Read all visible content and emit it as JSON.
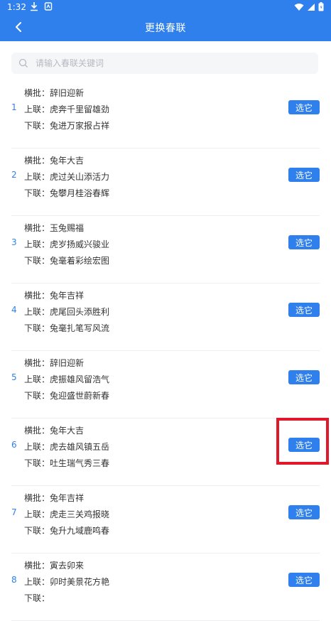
{
  "status_bar": {
    "time": "1:32"
  },
  "appbar": {
    "title": "更换春联"
  },
  "search": {
    "placeholder": "请输入春联关键词"
  },
  "labels": {
    "h": "横批：",
    "s": "上联：",
    "x": "下联：",
    "choose": "选它"
  },
  "items": [
    {
      "index": "1",
      "heng": "辞旧迎新",
      "shang": "虎奔千里留雄劲",
      "xia": "兔进万家报占祥"
    },
    {
      "index": "2",
      "heng": "兔年大吉",
      "shang": "虎过关山添活力",
      "xia": "兔攀月桂浴春辉"
    },
    {
      "index": "3",
      "heng": "玉兔赐福",
      "shang": "虎岁扬威兴骏业",
      "xia": "兔毫着彩绘宏图"
    },
    {
      "index": "4",
      "heng": "兔年吉祥",
      "shang": "虎尾回头添胜利",
      "xia": "兔毫扎笔写风流"
    },
    {
      "index": "5",
      "heng": "辞旧迎新",
      "shang": "虎振雄风留浩气",
      "xia": "兔迎盛世蔚新春"
    },
    {
      "index": "6",
      "heng": "兔年大吉",
      "shang": "虎去雄风镇五岳",
      "xia": "吐生瑞气秀三春"
    },
    {
      "index": "7",
      "heng": "兔年吉祥",
      "shang": "虎走三关鸡报晓",
      "xia": "兔升九域鹿鸣春"
    },
    {
      "index": "8",
      "heng": "寅去卯来",
      "shang": "卯时美景花方艳",
      "xia": ""
    }
  ],
  "colors": {
    "primary": "#2f80ed",
    "highlight": "#e0182b"
  }
}
